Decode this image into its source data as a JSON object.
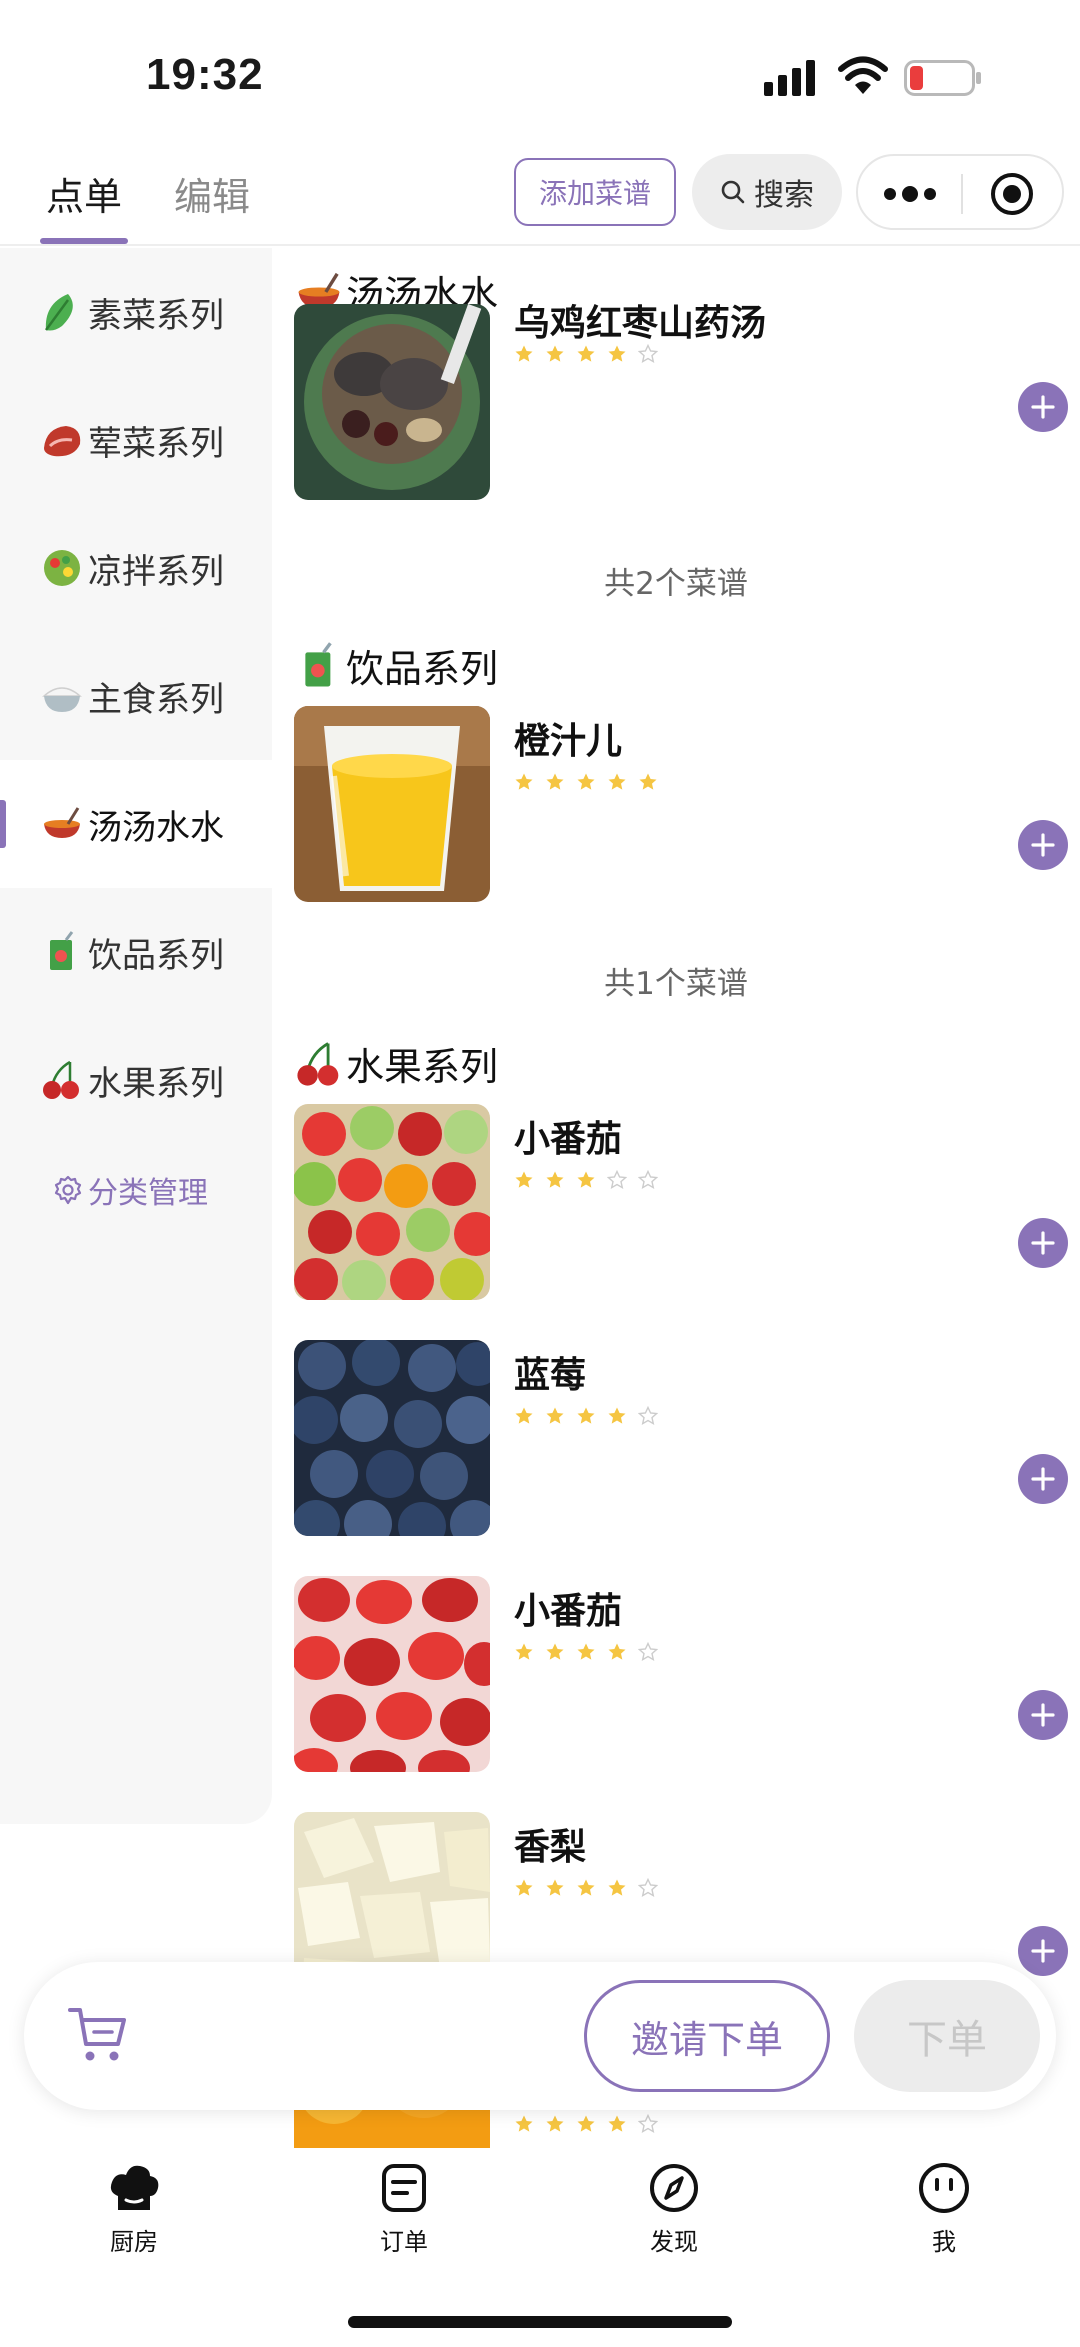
{
  "status_bar": {
    "time": "19:32"
  },
  "header": {
    "tabs": [
      {
        "label": "点单"
      },
      {
        "label": "编辑"
      }
    ],
    "add_recipe_label": "添加菜谱",
    "search_label": "搜索"
  },
  "sidebar": {
    "items": [
      {
        "label": "素菜系列",
        "icon": "leafy-greens-icon"
      },
      {
        "label": "荤菜系列",
        "icon": "meat-icon"
      },
      {
        "label": "凉拌系列",
        "icon": "salad-icon"
      },
      {
        "label": "主食系列",
        "icon": "rice-icon"
      },
      {
        "label": "汤汤水水",
        "icon": "soup-pot-icon",
        "active": true
      },
      {
        "label": "饮品系列",
        "icon": "juice-box-icon"
      },
      {
        "label": "水果系列",
        "icon": "cherries-icon"
      }
    ],
    "manage_label": "分类管理"
  },
  "sections": [
    {
      "title": "汤汤水水",
      "icon": "soup-pot-icon",
      "dishes": [
        {
          "name": "乌鸡红枣山药汤",
          "rating": 4
        }
      ],
      "count_text": "共2个菜谱"
    },
    {
      "title": "饮品系列",
      "icon": "juice-box-icon",
      "dishes": [
        {
          "name": "橙汁儿",
          "rating": 5
        }
      ],
      "count_text": "共1个菜谱"
    },
    {
      "title": "水果系列",
      "icon": "cherries-icon",
      "dishes": [
        {
          "name": "小番茄",
          "rating": 3
        },
        {
          "name": "蓝莓",
          "rating": 4
        },
        {
          "name": "小番茄",
          "rating": 4
        },
        {
          "name": "香梨",
          "rating": 4
        },
        {
          "name": "",
          "rating": 4
        }
      ]
    }
  ],
  "cart": {
    "invite_label": "邀请下单",
    "order_label": "下单"
  },
  "bottom_nav": [
    {
      "label": "厨房",
      "icon": "chef-hat-icon"
    },
    {
      "label": "订单",
      "icon": "order-list-icon"
    },
    {
      "label": "发现",
      "icon": "compass-icon"
    },
    {
      "label": "我",
      "icon": "smiley-face-icon"
    }
  ],
  "colors": {
    "accent": "#8a73b8",
    "star": "#f5c542",
    "star_empty": "#cccccc"
  }
}
